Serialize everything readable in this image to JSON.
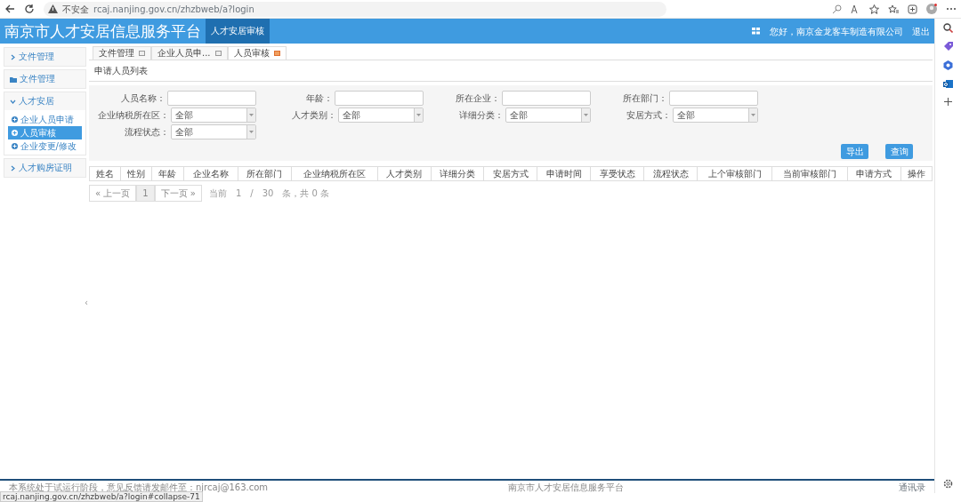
{
  "browser": {
    "security": "不安全",
    "url": "rcaj.nanjing.gov.cn/zhzbweb/a?login",
    "status_url": "rcaj.nanjing.gov.cn/zhzbweb/a?login#collapse-71"
  },
  "header": {
    "title": "南京市人才安居信息服务平台",
    "module_tabs": [
      {
        "label": "人才安居审核",
        "selected": true
      }
    ],
    "greeting": "您好，南京金龙客车制造有限公司",
    "logout": "退出"
  },
  "sidebar": {
    "panels": [
      {
        "kind": "group",
        "label": "文件管理",
        "expanded": false
      },
      {
        "kind": "link",
        "label": "文件管理"
      },
      {
        "kind": "group",
        "label": "人才安居",
        "expanded": true,
        "children": [
          {
            "label": "企业人员申请",
            "selected": false
          },
          {
            "label": "人员审核",
            "selected": true
          },
          {
            "label": "企业变更/修改",
            "selected": false
          }
        ]
      },
      {
        "kind": "group",
        "label": "人才购房证明",
        "expanded": false
      }
    ]
  },
  "collapse_handle": "‹",
  "tabs": [
    {
      "label": "文件管理",
      "selected": false
    },
    {
      "label": "企业人员申...",
      "selected": false
    },
    {
      "label": "人员审核",
      "selected": true
    }
  ],
  "subtabs": [
    {
      "label": "申请人员列表",
      "selected": true
    }
  ],
  "filters": [
    {
      "kind": "text",
      "label": "人员名称："
    },
    {
      "kind": "text",
      "label": "年龄："
    },
    {
      "kind": "text",
      "label": "所在企业："
    },
    {
      "kind": "text",
      "label": "所在部门："
    },
    {
      "kind": "select",
      "label": "企业纳税所在区：",
      "value": "全部"
    },
    {
      "kind": "select",
      "label": "人才类别：",
      "value": "全部"
    },
    {
      "kind": "select",
      "label": "详细分类：",
      "value": "全部"
    },
    {
      "kind": "select",
      "label": "安居方式：",
      "value": "全部"
    },
    {
      "kind": "select",
      "label": "流程状态：",
      "value": "全部"
    }
  ],
  "buttons": [
    "导出",
    "查询"
  ],
  "table": {
    "columns": [
      "姓名",
      "性别",
      "年龄",
      "企业名称",
      "所在部门",
      "企业纳税所在区",
      "人才类别",
      "详细分类",
      "安居方式",
      "申请时间",
      "享受状态",
      "流程状态",
      "上个审核部门",
      "当前审核部门",
      "申请方式",
      "操作"
    ]
  },
  "pagination": {
    "prev": "« 上一页",
    "pages": [
      {
        "label": "1",
        "selected": true
      }
    ],
    "next": "下一页 »",
    "info": "当前　1　/　30　条，共 0 条"
  },
  "footer": {
    "notice": "本系统处于试运行阶段，意见反馈请发邮件至：njrcaj@163.com",
    "center": "南京市人才安居信息服务平台",
    "right": "通讯录"
  }
}
